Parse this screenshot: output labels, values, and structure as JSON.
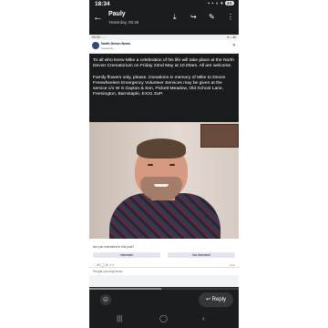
{
  "status": {
    "time": "18:34",
    "icons": "▪ ▪ ◗ ▾",
    "battery": "40"
  },
  "header": {
    "back_icon": "arrow-left-icon",
    "name": "Pauly",
    "subtitle": "Yesterday, 00:36"
  },
  "actions": [
    "download-icon",
    "share-icon",
    "edit-icon",
    "more-icon"
  ],
  "screenshot": {
    "status_left": "00:00 ◦ ◦ ◦",
    "status_right": "▾ ◗ 40",
    "page_name": "North Devon News",
    "date": "Facebook · ◦",
    "post_paragraphs": [
      "To all who knew Mike a celebration of his life will take place at the North Devon Crematorium on Friday 22nd May at 10.00am. All are welcome.",
      "Family flowers only, please. Donations in memory of Mike to Devon Freewheelers Emergency Volunteer Services may be given at the service c/o W S Gayton & Son, Pickett Meadow, Old School Lane, Fremington, Barnstaple, EX31 3UP."
    ],
    "survey_question": "Are you interested in this post?",
    "survey_options": [
      "Interested",
      "Not interested"
    ],
    "reaction_counts": "♡ 49   ◯ 15   ↗ 1",
    "reaction_icons": "●●●",
    "reply_prompt": "People you may know"
  },
  "video_progress_percent": 48,
  "footer": {
    "reply_label": "Reply"
  },
  "nav": [
    "recents-icon",
    "home-icon",
    "back-icon"
  ]
}
